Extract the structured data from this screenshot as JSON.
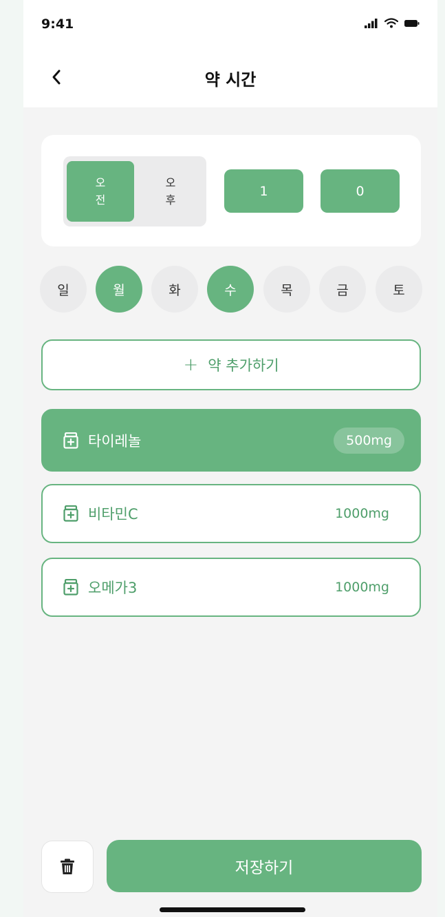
{
  "status_bar": {
    "time": "9:41"
  },
  "header": {
    "title": "약 시간"
  },
  "time_picker": {
    "am_label": "오\n전",
    "pm_label": "오\n후",
    "selected_period": "am",
    "hour": "1",
    "minute": "0"
  },
  "days": [
    {
      "label": "일",
      "active": false
    },
    {
      "label": "월",
      "active": true
    },
    {
      "label": "화",
      "active": false
    },
    {
      "label": "수",
      "active": true
    },
    {
      "label": "목",
      "active": false
    },
    {
      "label": "금",
      "active": false
    },
    {
      "label": "토",
      "active": false
    }
  ],
  "add_button": {
    "plus": "+",
    "label": "약 추가하기"
  },
  "medications": [
    {
      "name": "타이레놀",
      "dose": "500mg",
      "selected": true
    },
    {
      "name": "비타민C",
      "dose": "1000mg",
      "selected": false
    },
    {
      "name": "오메가3",
      "dose": "1000mg",
      "selected": false
    }
  ],
  "footer": {
    "save_label": "저장하기"
  },
  "colors": {
    "accent": "#67b480",
    "accent_text": "#4e9e6a",
    "background": "#f4f4f4"
  },
  "icons": {
    "back": "chevron-left-icon",
    "delete": "trash-icon",
    "medication": "pill-bottle-icon"
  }
}
